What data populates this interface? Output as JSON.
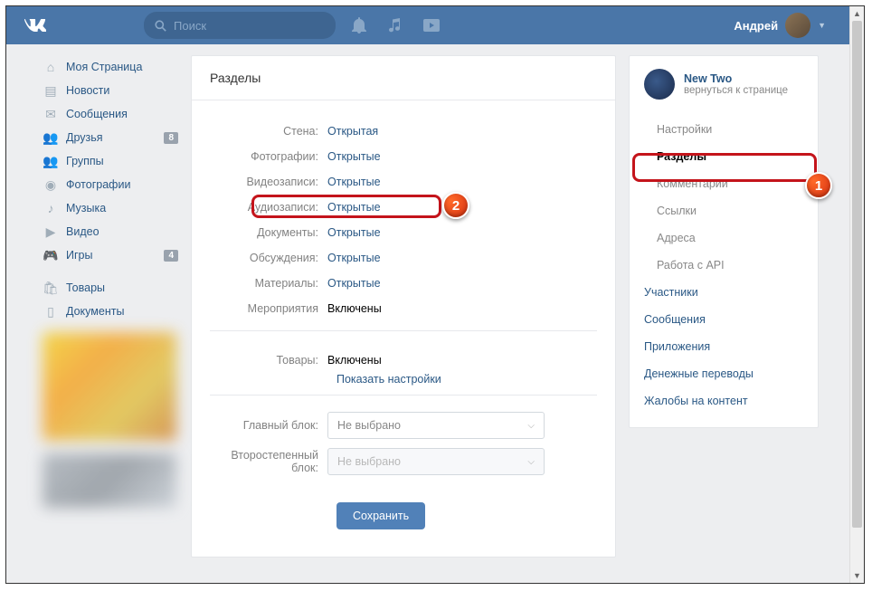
{
  "header": {
    "search_placeholder": "Поиск",
    "user_name": "Андрей"
  },
  "left_nav": {
    "items": [
      {
        "icon": "home",
        "label": "Моя Страница"
      },
      {
        "icon": "news",
        "label": "Новости"
      },
      {
        "icon": "msg",
        "label": "Сообщения"
      },
      {
        "icon": "friends",
        "label": "Друзья",
        "badge": "8"
      },
      {
        "icon": "groups",
        "label": "Группы"
      },
      {
        "icon": "photos",
        "label": "Фотографии"
      },
      {
        "icon": "music",
        "label": "Музыка"
      },
      {
        "icon": "video",
        "label": "Видео"
      },
      {
        "icon": "games",
        "label": "Игры",
        "badge": "4"
      }
    ],
    "items2": [
      {
        "icon": "bag",
        "label": "Товары"
      },
      {
        "icon": "docs",
        "label": "Документы"
      }
    ]
  },
  "main": {
    "title": "Разделы",
    "rows": [
      {
        "label": "Стена:",
        "value": "Открытая",
        "link": true
      },
      {
        "label": "Фотографии:",
        "value": "Открытые",
        "link": true
      },
      {
        "label": "Видеозаписи:",
        "value": "Открытые",
        "link": true
      },
      {
        "label": "Аудиозаписи:",
        "value": "Открытые",
        "link": true,
        "highlight": true,
        "marker": "2"
      },
      {
        "label": "Документы:",
        "value": "Открытые",
        "link": true
      },
      {
        "label": "Обсуждения:",
        "value": "Открытые",
        "link": true
      },
      {
        "label": "Материалы:",
        "value": "Открытые",
        "link": true
      },
      {
        "label": "Мероприятия",
        "value": "Включены",
        "black": true
      }
    ],
    "goods_label": "Товары:",
    "goods_value": "Включены",
    "show_settings": "Показать настройки",
    "main_block_label": "Главный блок:",
    "main_block_value": "Не выбрано",
    "secondary_block_label": "Второстепенный блок:",
    "secondary_block_value": "Не выбрано",
    "save": "Сохранить"
  },
  "right": {
    "group_name": "New Two",
    "back": "вернуться к странице",
    "items": [
      {
        "label": "Настройки",
        "type": "sub"
      },
      {
        "label": "Разделы",
        "type": "sub",
        "active": true,
        "highlight": true,
        "marker": "1"
      },
      {
        "label": "Комментарии",
        "type": "sub"
      },
      {
        "label": "Ссылки",
        "type": "sub"
      },
      {
        "label": "Адреса",
        "type": "sub"
      },
      {
        "label": "Работа с API",
        "type": "sub"
      },
      {
        "label": "Участники",
        "type": "top"
      },
      {
        "label": "Сообщения",
        "type": "top"
      },
      {
        "label": "Приложения",
        "type": "top"
      },
      {
        "label": "Денежные переводы",
        "type": "top"
      },
      {
        "label": "Жалобы на контент",
        "type": "top"
      }
    ]
  }
}
